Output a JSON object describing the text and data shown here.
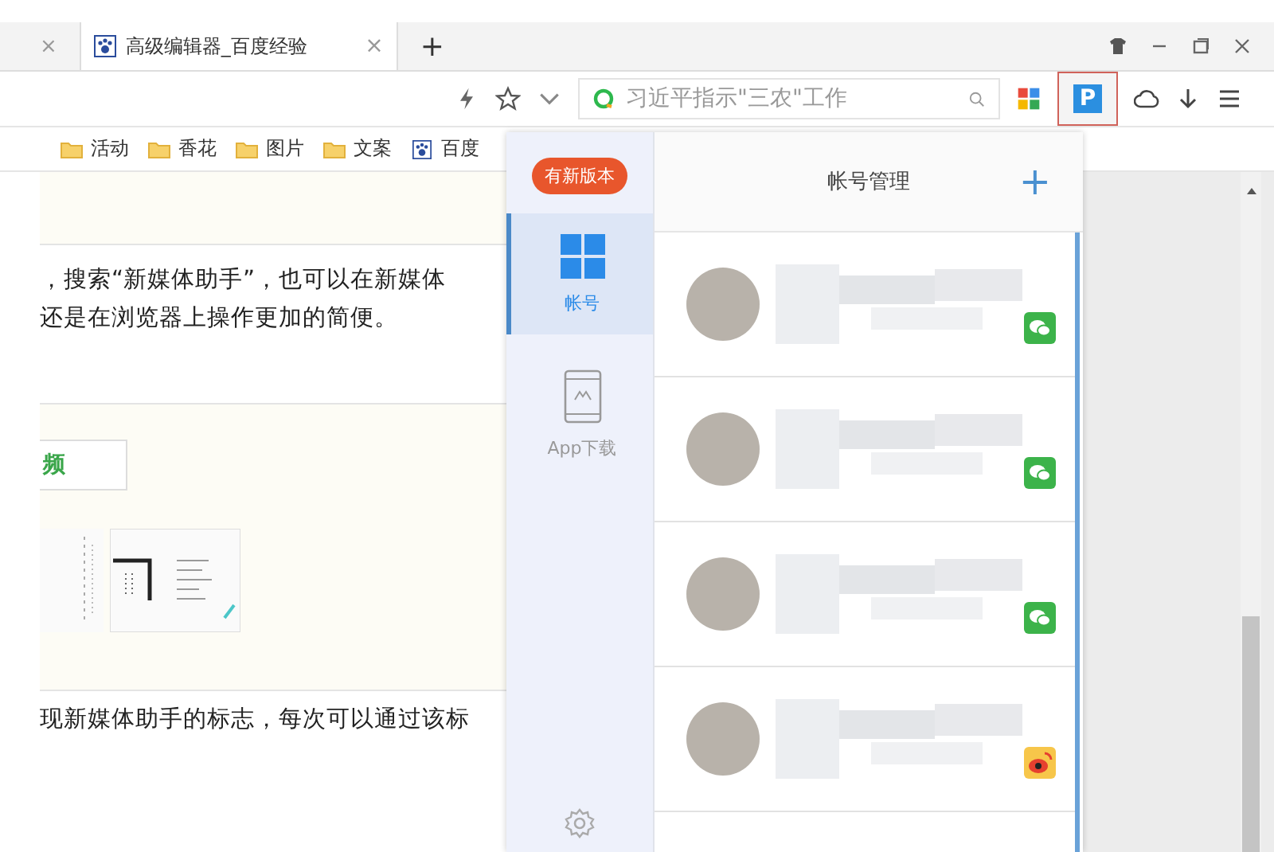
{
  "tabs": [
    {
      "label": "高级编辑器_百度经验",
      "selected": true,
      "close": "×"
    }
  ],
  "new_tab": "+",
  "partial_tab_close": "×",
  "address_bar": {
    "search_value": "习近平指示\"三农\"工作"
  },
  "extension_button": {
    "label": "P",
    "highlighted": true
  },
  "bookmarks": [
    {
      "label": "活动",
      "kind": "folder"
    },
    {
      "label": "香花",
      "kind": "folder"
    },
    {
      "label": "图片",
      "kind": "folder"
    },
    {
      "label": "文案",
      "kind": "folder"
    },
    {
      "label": "百度",
      "kind": "site"
    }
  ],
  "page": {
    "paragraph_1": [
      "，搜索“新媒体助手”，也可以在新媒体",
      "还是在浏览器上操作更加的简便。"
    ],
    "tab_button": "频",
    "paragraph_2": "现新媒体助手的标志，每次可以通过该标"
  },
  "popup": {
    "badge": "有新版本",
    "nav": [
      {
        "label": "帐号",
        "kind": "accounts",
        "selected": true
      },
      {
        "label": "App下载",
        "kind": "download",
        "selected": false
      }
    ],
    "title": "帐号管理",
    "add": "+",
    "accounts": [
      {
        "kind": "wechat"
      },
      {
        "kind": "wechat"
      },
      {
        "kind": "wechat"
      },
      {
        "kind": "weibo"
      }
    ]
  }
}
